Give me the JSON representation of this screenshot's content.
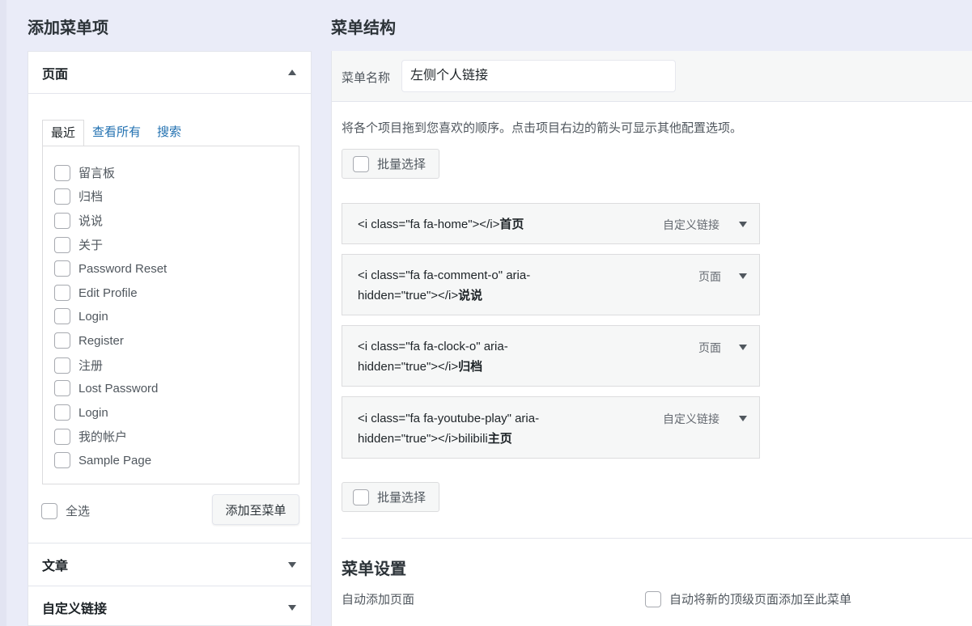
{
  "left": {
    "title": "添加菜单项",
    "pages_section": {
      "heading": "页面",
      "tabs": [
        "最近",
        "查看所有",
        "搜索"
      ],
      "items": [
        "留言板",
        "归档",
        "说说",
        "关于",
        "Password Reset",
        "Edit Profile",
        "Login",
        "Register",
        "注册",
        "Lost Password",
        "Login",
        "我的帐户",
        "Sample Page"
      ],
      "select_all": "全选",
      "add_button": "添加至菜单"
    },
    "posts_section": {
      "heading": "文章"
    },
    "custom_links_section": {
      "heading": "自定义链接"
    }
  },
  "right": {
    "title": "菜单结构",
    "menu_name_label": "菜单名称",
    "menu_name_value": "左侧个人链接",
    "instructions": "将各个项目拖到您喜欢的顺序。点击项目右边的箭头可显示其他配置选项。",
    "bulk_select": "批量选择",
    "menu_items": [
      {
        "line1": "<i class=\"fa fa-home\"></i>",
        "bold": "首页",
        "line2": "",
        "type": "自定义链接"
      },
      {
        "line1": "<i class=\"fa fa-comment-o\" aria-",
        "line2": "hidden=\"true\"></i>",
        "bold": "说说",
        "type": "页面"
      },
      {
        "line1": "<i class=\"fa fa-clock-o\" aria-",
        "line2": "hidden=\"true\"></i>",
        "bold": "归档",
        "type": "页面"
      },
      {
        "line1": "<i class=\"fa fa-youtube-play\" aria-",
        "line2": "hidden=\"true\"></i>bilibili",
        "bold": "主页",
        "type": "自定义链接"
      }
    ],
    "settings": {
      "title": "菜单设置",
      "auto_add_label": "自动添加页面",
      "auto_add_option": "自动将新的顶级页面添加至此菜单"
    }
  }
}
